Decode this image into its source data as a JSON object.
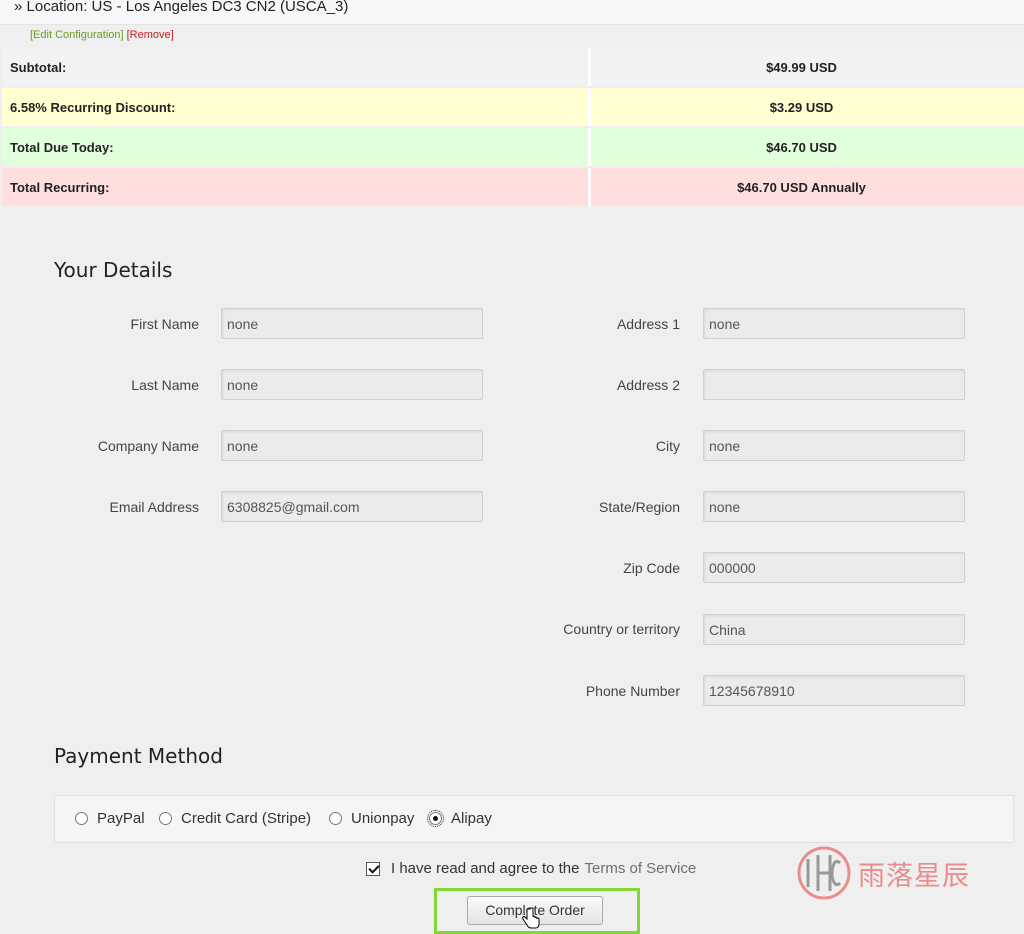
{
  "cart": {
    "location": "» Location: US - Los Angeles DC3 CN2 (USCA_3)",
    "edit_configuration": "[Edit Configuration]",
    "remove": "[Remove]"
  },
  "summary": [
    {
      "label": "Subtotal:",
      "value": "$49.99 USD"
    },
    {
      "label": "6.58% Recurring Discount:",
      "value": "$3.29 USD"
    },
    {
      "label": "Total Due Today:",
      "value": "$46.70 USD"
    },
    {
      "label": "Total Recurring:",
      "value": "$46.70 USD Annually"
    }
  ],
  "details": {
    "heading": "Your Details",
    "left": [
      {
        "label": "First Name",
        "value": "none"
      },
      {
        "label": "Last Name",
        "value": "none"
      },
      {
        "label": "Company Name",
        "value": "none"
      },
      {
        "label": "Email Address",
        "value": "6308825@gmail.com"
      }
    ],
    "right": [
      {
        "label": "Address 1",
        "value": "none"
      },
      {
        "label": "Address 2",
        "value": ""
      },
      {
        "label": "City",
        "value": "none"
      },
      {
        "label": "State/Region",
        "value": "none"
      },
      {
        "label": "Zip Code",
        "value": "000000"
      },
      {
        "label": "Country or territory",
        "value": "China"
      },
      {
        "label": "Phone Number",
        "value": "12345678910"
      }
    ]
  },
  "payment": {
    "heading": "Payment Method",
    "options": [
      "PayPal",
      "Credit Card (Stripe)",
      "Unionpay",
      "Alipay"
    ],
    "selected": "Alipay"
  },
  "agreement": {
    "text": "I have read and agree to the",
    "link": "Terms of Service",
    "checked": true
  },
  "submit_label": "Complete Order",
  "watermark": {
    "text": "雨落星辰",
    "logo": "hc-logo-icon",
    "color": "#e98c8c"
  }
}
